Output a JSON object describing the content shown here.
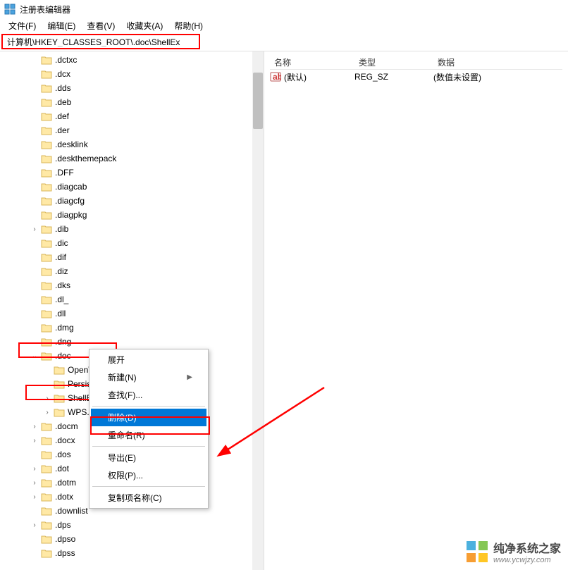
{
  "window": {
    "title": "注册表编辑器"
  },
  "menubar": [
    "文件(F)",
    "编辑(E)",
    "查看(V)",
    "收藏夹(A)",
    "帮助(H)"
  ],
  "addressbar": {
    "value": "计算机\\HKEY_CLASSES_ROOT\\.doc\\ShellEx"
  },
  "tree": [
    {
      "label": ".dctxc",
      "depth": 2,
      "exp": ""
    },
    {
      "label": ".dcx",
      "depth": 2,
      "exp": ""
    },
    {
      "label": ".dds",
      "depth": 2,
      "exp": ""
    },
    {
      "label": ".deb",
      "depth": 2,
      "exp": ""
    },
    {
      "label": ".def",
      "depth": 2,
      "exp": ""
    },
    {
      "label": ".der",
      "depth": 2,
      "exp": ""
    },
    {
      "label": ".desklink",
      "depth": 2,
      "exp": ""
    },
    {
      "label": ".deskthemepack",
      "depth": 2,
      "exp": ""
    },
    {
      "label": ".DFF",
      "depth": 2,
      "exp": ""
    },
    {
      "label": ".diagcab",
      "depth": 2,
      "exp": ""
    },
    {
      "label": ".diagcfg",
      "depth": 2,
      "exp": ""
    },
    {
      "label": ".diagpkg",
      "depth": 2,
      "exp": ""
    },
    {
      "label": ".dib",
      "depth": 2,
      "exp": ">"
    },
    {
      "label": ".dic",
      "depth": 2,
      "exp": ""
    },
    {
      "label": ".dif",
      "depth": 2,
      "exp": ""
    },
    {
      "label": ".diz",
      "depth": 2,
      "exp": ""
    },
    {
      "label": ".dks",
      "depth": 2,
      "exp": ""
    },
    {
      "label": ".dl_",
      "depth": 2,
      "exp": ""
    },
    {
      "label": ".dll",
      "depth": 2,
      "exp": ""
    },
    {
      "label": ".dmg",
      "depth": 2,
      "exp": ""
    },
    {
      "label": ".dng",
      "depth": 2,
      "exp": ""
    },
    {
      "label": ".doc",
      "depth": 2,
      "exp": "v"
    },
    {
      "label": "OpenWithProgids",
      "depth": 3,
      "exp": ""
    },
    {
      "label": "PersistentHandler",
      "depth": 3,
      "exp": ""
    },
    {
      "label": "ShellEx",
      "depth": 3,
      "exp": ">"
    },
    {
      "label": "WPS.",
      "depth": 3,
      "exp": ">"
    },
    {
      "label": ".docm",
      "depth": 2,
      "exp": ">"
    },
    {
      "label": ".docx",
      "depth": 2,
      "exp": ">"
    },
    {
      "label": ".dos",
      "depth": 2,
      "exp": ""
    },
    {
      "label": ".dot",
      "depth": 2,
      "exp": ">"
    },
    {
      "label": ".dotm",
      "depth": 2,
      "exp": ">"
    },
    {
      "label": ".dotx",
      "depth": 2,
      "exp": ">"
    },
    {
      "label": ".downlist",
      "depth": 2,
      "exp": ""
    },
    {
      "label": ".dps",
      "depth": 2,
      "exp": ">"
    },
    {
      "label": ".dpso",
      "depth": 2,
      "exp": ""
    },
    {
      "label": ".dpss",
      "depth": 2,
      "exp": ""
    }
  ],
  "list": {
    "headers": {
      "name": "名称",
      "type": "类型",
      "data": "数据"
    },
    "rows": [
      {
        "name": "(默认)",
        "type": "REG_SZ",
        "data": "(数值未设置)"
      }
    ]
  },
  "context_menu": [
    {
      "label": "展开",
      "kind": "item"
    },
    {
      "label": "新建(N)",
      "kind": "submenu"
    },
    {
      "label": "查找(F)...",
      "kind": "item"
    },
    {
      "kind": "sep"
    },
    {
      "label": "删除(D)",
      "kind": "item",
      "selected": true
    },
    {
      "label": "重命名(R)",
      "kind": "item"
    },
    {
      "kind": "sep"
    },
    {
      "label": "导出(E)",
      "kind": "item"
    },
    {
      "label": "权限(P)...",
      "kind": "item"
    },
    {
      "kind": "sep"
    },
    {
      "label": "复制项名称(C)",
      "kind": "item"
    }
  ],
  "watermark": {
    "cn": "纯净系统之家",
    "url": "www.ycwjzy.com"
  }
}
